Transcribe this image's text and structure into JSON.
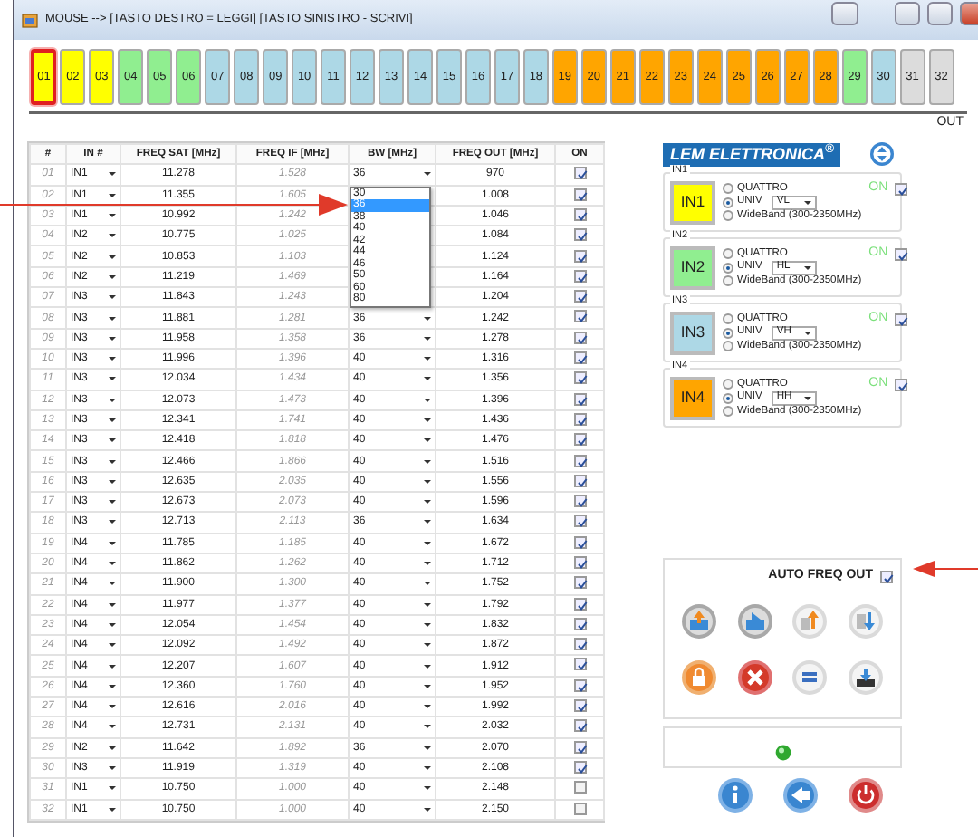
{
  "window": {
    "title": "MOUSE --> [TASTO DESTRO = LEGGI] [TASTO SINISTRO - SCRIVI]"
  },
  "outputs": [
    {
      "label": "01",
      "color": "#ffff00",
      "selected": true
    },
    {
      "label": "02",
      "color": "#ffff00",
      "selected": false
    },
    {
      "label": "03",
      "color": "#ffff00",
      "selected": false
    },
    {
      "label": "04",
      "color": "#90ee90",
      "selected": false
    },
    {
      "label": "05",
      "color": "#90ee90",
      "selected": false
    },
    {
      "label": "06",
      "color": "#90ee90",
      "selected": false
    },
    {
      "label": "07",
      "color": "#add8e6",
      "selected": false
    },
    {
      "label": "08",
      "color": "#add8e6",
      "selected": false
    },
    {
      "label": "09",
      "color": "#add8e6",
      "selected": false
    },
    {
      "label": "10",
      "color": "#add8e6",
      "selected": false
    },
    {
      "label": "11",
      "color": "#add8e6",
      "selected": false
    },
    {
      "label": "12",
      "color": "#add8e6",
      "selected": false
    },
    {
      "label": "13",
      "color": "#add8e6",
      "selected": false
    },
    {
      "label": "14",
      "color": "#add8e6",
      "selected": false
    },
    {
      "label": "15",
      "color": "#add8e6",
      "selected": false
    },
    {
      "label": "16",
      "color": "#add8e6",
      "selected": false
    },
    {
      "label": "17",
      "color": "#add8e6",
      "selected": false
    },
    {
      "label": "18",
      "color": "#add8e6",
      "selected": false
    },
    {
      "label": "19",
      "color": "#ffa500",
      "selected": false
    },
    {
      "label": "20",
      "color": "#ffa500",
      "selected": false
    },
    {
      "label": "21",
      "color": "#ffa500",
      "selected": false
    },
    {
      "label": "22",
      "color": "#ffa500",
      "selected": false
    },
    {
      "label": "23",
      "color": "#ffa500",
      "selected": false
    },
    {
      "label": "24",
      "color": "#ffa500",
      "selected": false
    },
    {
      "label": "25",
      "color": "#ffa500",
      "selected": false
    },
    {
      "label": "26",
      "color": "#ffa500",
      "selected": false
    },
    {
      "label": "27",
      "color": "#ffa500",
      "selected": false
    },
    {
      "label": "28",
      "color": "#ffa500",
      "selected": false
    },
    {
      "label": "29",
      "color": "#90ee90",
      "selected": false
    },
    {
      "label": "30",
      "color": "#add8e6",
      "selected": false
    },
    {
      "label": "31",
      "color": "#dcdcdc",
      "selected": false
    },
    {
      "label": "32",
      "color": "#dcdcdc",
      "selected": false
    }
  ],
  "out_label": "OUT",
  "table": {
    "columns": [
      "#",
      "IN #",
      "FREQ SAT [MHz]",
      "FREQ IF [MHz]",
      "BW [MHz]",
      "FREQ OUT [MHz]",
      "ON"
    ],
    "rows": [
      {
        "num": "01",
        "input": "IN1",
        "freq_sat": "11.278",
        "freq_if": "1.528",
        "bw": "36",
        "freq_out": "970",
        "on": true
      },
      {
        "num": "02",
        "input": "IN1",
        "freq_sat": "11.355",
        "freq_if": "1.605",
        "freq_out": "1.008",
        "on": true
      },
      {
        "num": "03",
        "input": "IN1",
        "freq_sat": "10.992",
        "freq_if": "1.242",
        "freq_out": "1.046",
        "on": true
      },
      {
        "num": "04",
        "input": "IN2",
        "freq_sat": "10.775",
        "freq_if": "1.025",
        "freq_out": "1.084",
        "on": true
      },
      {
        "num": "05",
        "input": "IN2",
        "freq_sat": "10.853",
        "freq_if": "1.103",
        "freq_out": "1.124",
        "on": true
      },
      {
        "num": "06",
        "input": "IN2",
        "freq_sat": "11.219",
        "freq_if": "1.469",
        "freq_out": "1.164",
        "on": true
      },
      {
        "num": "07",
        "input": "IN3",
        "freq_sat": "11.843",
        "freq_if": "1.243",
        "freq_out": "1.204",
        "on": true
      },
      {
        "num": "08",
        "input": "IN3",
        "freq_sat": "11.881",
        "freq_if": "1.281",
        "bw": "36",
        "freq_out": "1.242",
        "on": true
      },
      {
        "num": "09",
        "input": "IN3",
        "freq_sat": "11.958",
        "freq_if": "1.358",
        "bw": "36",
        "freq_out": "1.278",
        "on": true
      },
      {
        "num": "10",
        "input": "IN3",
        "freq_sat": "11.996",
        "freq_if": "1.396",
        "bw": "40",
        "freq_out": "1.316",
        "on": true
      },
      {
        "num": "11",
        "input": "IN3",
        "freq_sat": "12.034",
        "freq_if": "1.434",
        "bw": "40",
        "freq_out": "1.356",
        "on": true
      },
      {
        "num": "12",
        "input": "IN3",
        "freq_sat": "12.073",
        "freq_if": "1.473",
        "bw": "40",
        "freq_out": "1.396",
        "on": true
      },
      {
        "num": "13",
        "input": "IN3",
        "freq_sat": "12.341",
        "freq_if": "1.741",
        "bw": "40",
        "freq_out": "1.436",
        "on": true
      },
      {
        "num": "14",
        "input": "IN3",
        "freq_sat": "12.418",
        "freq_if": "1.818",
        "bw": "40",
        "freq_out": "1.476",
        "on": true
      },
      {
        "num": "15",
        "input": "IN3",
        "freq_sat": "12.466",
        "freq_if": "1.866",
        "bw": "40",
        "freq_out": "1.516",
        "on": true
      },
      {
        "num": "16",
        "input": "IN3",
        "freq_sat": "12.635",
        "freq_if": "2.035",
        "bw": "40",
        "freq_out": "1.556",
        "on": true
      },
      {
        "num": "17",
        "input": "IN3",
        "freq_sat": "12.673",
        "freq_if": "2.073",
        "bw": "40",
        "freq_out": "1.596",
        "on": true
      },
      {
        "num": "18",
        "input": "IN3",
        "freq_sat": "12.713",
        "freq_if": "2.113",
        "bw": "36",
        "freq_out": "1.634",
        "on": true
      },
      {
        "num": "19",
        "input": "IN4",
        "freq_sat": "11.785",
        "freq_if": "1.185",
        "bw": "40",
        "freq_out": "1.672",
        "on": true
      },
      {
        "num": "20",
        "input": "IN4",
        "freq_sat": "11.862",
        "freq_if": "1.262",
        "bw": "40",
        "freq_out": "1.712",
        "on": true
      },
      {
        "num": "21",
        "input": "IN4",
        "freq_sat": "11.900",
        "freq_if": "1.300",
        "bw": "40",
        "freq_out": "1.752",
        "on": true
      },
      {
        "num": "22",
        "input": "IN4",
        "freq_sat": "11.977",
        "freq_if": "1.377",
        "bw": "40",
        "freq_out": "1.792",
        "on": true
      },
      {
        "num": "23",
        "input": "IN4",
        "freq_sat": "12.054",
        "freq_if": "1.454",
        "bw": "40",
        "freq_out": "1.832",
        "on": true
      },
      {
        "num": "24",
        "input": "IN4",
        "freq_sat": "12.092",
        "freq_if": "1.492",
        "bw": "40",
        "freq_out": "1.872",
        "on": true
      },
      {
        "num": "25",
        "input": "IN4",
        "freq_sat": "12.207",
        "freq_if": "1.607",
        "bw": "40",
        "freq_out": "1.912",
        "on": true
      },
      {
        "num": "26",
        "input": "IN4",
        "freq_sat": "12.360",
        "freq_if": "1.760",
        "bw": "40",
        "freq_out": "1.952",
        "on": true
      },
      {
        "num": "27",
        "input": "IN4",
        "freq_sat": "12.616",
        "freq_if": "2.016",
        "bw": "40",
        "freq_out": "1.992",
        "on": true
      },
      {
        "num": "28",
        "input": "IN4",
        "freq_sat": "12.731",
        "freq_if": "2.131",
        "bw": "40",
        "freq_out": "2.032",
        "on": true
      },
      {
        "num": "29",
        "input": "IN2",
        "freq_sat": "11.642",
        "freq_if": "1.892",
        "bw": "36",
        "freq_out": "2.070",
        "on": true
      },
      {
        "num": "30",
        "input": "IN3",
        "freq_sat": "11.919",
        "freq_if": "1.319",
        "bw": "40",
        "freq_out": "2.108",
        "on": true
      },
      {
        "num": "31",
        "input": "IN1",
        "freq_sat": "10.750",
        "freq_if": "1.000",
        "bw": "40",
        "freq_out": "2.148",
        "on": false
      },
      {
        "num": "32",
        "input": "IN1",
        "freq_sat": "10.750",
        "freq_if": "1.000",
        "bw": "40",
        "freq_out": "2.150",
        "on": false
      }
    ]
  },
  "bw_dropdown": {
    "options": [
      {
        "label": "30",
        "selected": false
      },
      {
        "label": "36",
        "selected": true
      },
      {
        "label": "38",
        "selected": false
      },
      {
        "label": "40",
        "selected": false
      },
      {
        "label": "42",
        "selected": false
      },
      {
        "label": "44",
        "selected": false
      },
      {
        "label": "46",
        "selected": false
      },
      {
        "label": "50",
        "selected": false
      },
      {
        "label": "60",
        "selected": false
      },
      {
        "label": "80",
        "selected": false
      }
    ]
  },
  "logo": "LEM ELETTRONICA$^{®}$",
  "inputs": [
    {
      "legend": "IN1",
      "label": "IN1",
      "color": "#ffff00",
      "modes": [
        {
          "label": "QUATTRO",
          "selected": false
        },
        {
          "label": "UNIV",
          "selected": true
        },
        {
          "label": "WideBand (300-2350MHz)",
          "selected": false
        }
      ],
      "polarization": "VL",
      "on_label": "ON",
      "on": true
    },
    {
      "legend": "IN2",
      "label": "IN2",
      "color": "#90ee90",
      "modes": [
        {
          "label": "QUATTRO",
          "selected": false
        },
        {
          "label": "UNIV",
          "selected": true
        },
        {
          "label": "WideBand (300-2350MHz)",
          "selected": false
        }
      ],
      "polarization": "HL",
      "on_label": "ON",
      "on": true
    },
    {
      "legend": "IN3",
      "label": "IN3",
      "color": "#add8e6",
      "modes": [
        {
          "label": "QUATTRO",
          "selected": false
        },
        {
          "label": "UNIV",
          "selected": true
        },
        {
          "label": "WideBand (300-2350MHz)",
          "selected": false
        }
      ],
      "polarization": "VH",
      "on_label": "ON",
      "on": true
    },
    {
      "legend": "IN4",
      "label": "IN4",
      "color": "#ffa500",
      "modes": [
        {
          "label": "QUATTRO",
          "selected": false
        },
        {
          "label": "UNIV",
          "selected": true
        },
        {
          "label": "WideBand (300-2350MHz)",
          "selected": false
        }
      ],
      "polarization": "HH",
      "on_label": "ON",
      "on": true
    }
  ],
  "auto_freq_out": {
    "label": "AUTO FREQ OUT",
    "checked": true
  }
}
